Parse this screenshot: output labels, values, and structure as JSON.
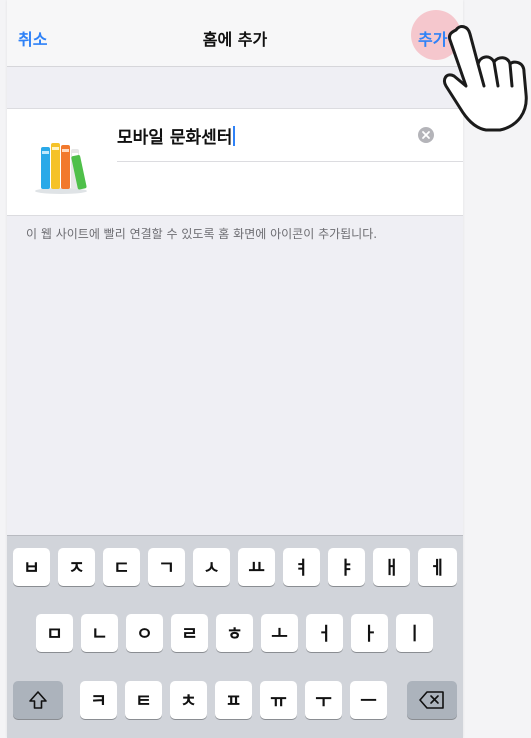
{
  "navbar": {
    "cancel_label": "취소",
    "title": "홈에 추가",
    "add_label": "추가"
  },
  "shortcut": {
    "name_value": "모바일 문화센터",
    "icon": "books-icon",
    "clear_icon": "clear-circle-icon"
  },
  "helper_text": "이 웹 사이트에 빨리 연결할 수 있도록 홈 화면에 아이콘이 추가됩니다.",
  "keyboard": {
    "row1": [
      "ㅂ",
      "ㅈ",
      "ㄷ",
      "ㄱ",
      "ㅅ",
      "ㅛ",
      "ㅕ",
      "ㅑ",
      "ㅐ",
      "ㅔ"
    ],
    "row2": [
      "ㅁ",
      "ㄴ",
      "ㅇ",
      "ㄹ",
      "ㅎ",
      "ㅗ",
      "ㅓ",
      "ㅏ",
      "ㅣ"
    ],
    "row3": [
      "ㅋ",
      "ㅌ",
      "ㅊ",
      "ㅍ",
      "ㅠ",
      "ㅜ",
      "ㅡ"
    ],
    "shift_icon": "shift-arrow-icon",
    "delete_icon": "backspace-icon"
  },
  "pointer": "hand-pointer-icon",
  "colors": {
    "accent": "#2f82f7",
    "tap_highlight": "#f4a0aa"
  }
}
